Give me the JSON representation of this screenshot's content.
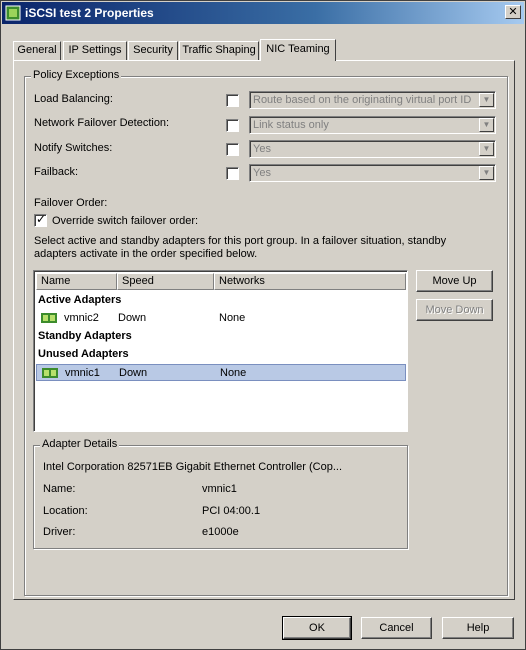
{
  "window": {
    "title": "iSCSI test 2 Properties",
    "close": "✕"
  },
  "tabs": [
    {
      "label": "General"
    },
    {
      "label": "IP Settings"
    },
    {
      "label": "Security"
    },
    {
      "label": "Traffic Shaping"
    },
    {
      "label": "NIC Teaming",
      "active": true
    }
  ],
  "policy": {
    "group_title": "Policy Exceptions",
    "load_balancing": {
      "label": "Load Balancing:",
      "value": "Route based on the originating virtual port ID"
    },
    "failover_detection": {
      "label": "Network Failover Detection:",
      "value": "Link status only"
    },
    "notify_switches": {
      "label": "Notify Switches:",
      "value": "Yes"
    },
    "failback": {
      "label": "Failback:",
      "value": "Yes"
    },
    "failover_order_label": "Failover Order:",
    "override_label": "Override switch failover order:",
    "description_line1": "Select active and standby adapters for this port group.  In a failover situation, standby",
    "description_line2": "adapters activate  in the order specified below."
  },
  "adapters": {
    "columns": [
      "Name",
      "Speed",
      "Networks"
    ],
    "active_header": "Active Adapters",
    "standby_header": "Standby Adapters",
    "unused_header": "Unused Adapters",
    "active": [
      {
        "name": "vmnic2",
        "speed": "Down",
        "networks": "None"
      }
    ],
    "unused": [
      {
        "name": "vmnic1",
        "speed": "Down",
        "networks": "None"
      }
    ]
  },
  "buttons": {
    "move_up": "Move Up",
    "move_down": "Move Down",
    "ok": "OK",
    "cancel": "Cancel",
    "help": "Help"
  },
  "details": {
    "group_title": "Adapter Details",
    "description": "Intel Corporation 82571EB Gigabit Ethernet Controller (Cop...",
    "name_label": "Name:",
    "name_value": "vmnic1",
    "location_label": "Location:",
    "location_value": "PCI 04:00.1",
    "driver_label": "Driver:",
    "driver_value": "e1000e"
  },
  "colors": {
    "selection": "#b9c9e5",
    "nic_icon": "#3c8c2c"
  }
}
